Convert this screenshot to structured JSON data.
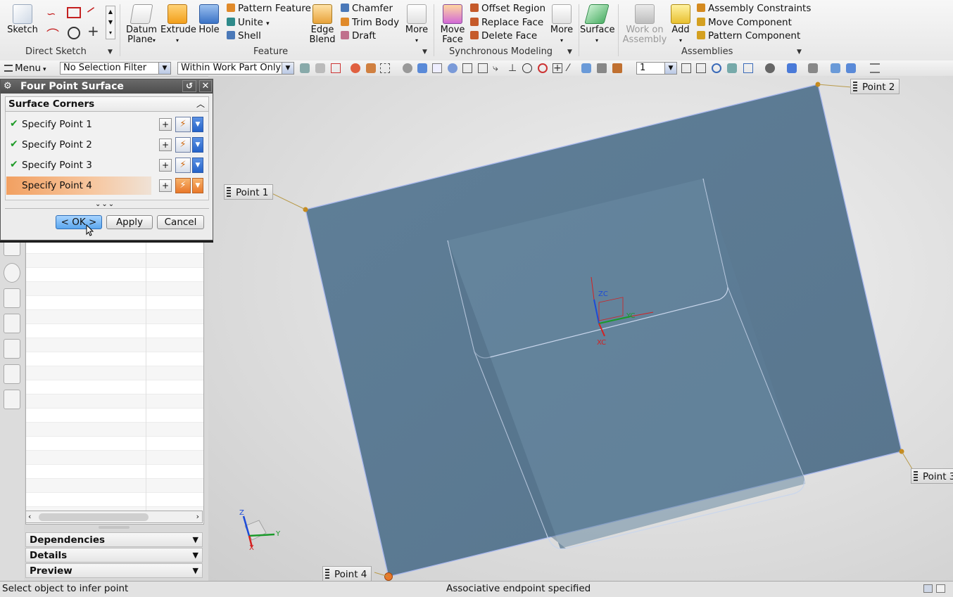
{
  "ribbon": {
    "direct_sketch": {
      "sketch_label": "Sketch",
      "group_label": "Direct Sketch"
    },
    "feature": {
      "datum_plane_label": [
        "Datum",
        "Plane"
      ],
      "extrude_label": "Extrude",
      "hole_label": "Hole",
      "pattern_feature_label": "Pattern Feature",
      "unite_label": "Unite",
      "shell_label": "Shell",
      "edge_blend_label": [
        "Edge",
        "Blend"
      ],
      "chamfer_label": "Chamfer",
      "trim_body_label": "Trim Body",
      "draft_label": "Draft",
      "more_label": "More",
      "group_label": "Feature"
    },
    "synchronous": {
      "move_face_label": [
        "Move",
        "Face"
      ],
      "offset_region_label": "Offset Region",
      "replace_face_label": "Replace Face",
      "delete_face_label": "Delete Face",
      "more_label": "More",
      "group_label": "Synchronous Modeling"
    },
    "surface_label": "Surface",
    "assemblies": {
      "work_on_assembly_label": [
        "Work on",
        "Assembly"
      ],
      "add_label": "Add",
      "assembly_constraints_label": "Assembly Constraints",
      "move_component_label": "Move Component",
      "pattern_component_label": "Pattern Component",
      "group_label": "Assemblies"
    }
  },
  "toolbar": {
    "menu_label": "Menu",
    "selection_filter": "No Selection Filter",
    "scope": "Within Work Part Only",
    "layer_value": "1"
  },
  "dialog": {
    "title": "Four Point Surface",
    "group_title": "Surface Corners",
    "points": [
      {
        "label": "Specify Point 1",
        "done": true
      },
      {
        "label": "Specify Point 2",
        "done": true
      },
      {
        "label": "Specify Point 3",
        "done": true
      },
      {
        "label": "Specify Point 4",
        "done": true,
        "active": true
      }
    ],
    "ok_label": "< OK >",
    "apply_label": "Apply",
    "cancel_label": "Cancel"
  },
  "navigator": {
    "sections": [
      "Dependencies",
      "Details",
      "Preview"
    ]
  },
  "viewport": {
    "point_labels": [
      "Point 1",
      "Point 2",
      "Point 3",
      "Point 4"
    ],
    "wcs_labels": {
      "zc": "ZC",
      "yc": "YC",
      "xc": "XC"
    },
    "triad_labels": {
      "z": "Z",
      "y": "Y",
      "x": "X"
    }
  },
  "status": {
    "left": "Select object to infer point",
    "center": "Associative endpoint specified"
  },
  "colors": {
    "surface": "#5f7f98",
    "surface_edge": "#a9b8ee",
    "accent_orange": "#e9782a",
    "ok_blue": "#5aa6ee"
  }
}
